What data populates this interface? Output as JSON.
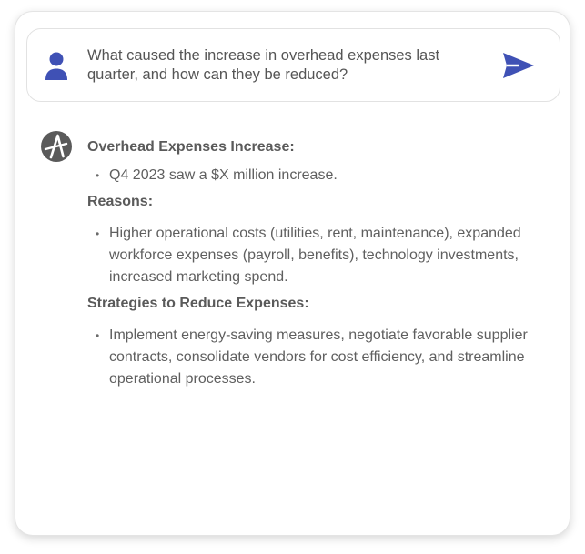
{
  "query": {
    "text": "What caused the increase in overhead expenses last quarter, and how can they be reduced?",
    "user_icon": "user-icon",
    "send_icon": "send-icon"
  },
  "response": {
    "assistant_icon": "assistant-logo-icon",
    "sections": [
      {
        "heading": "Overhead Expenses Increase:",
        "bullets": [
          "Q4 2023 saw a $X million increase."
        ]
      },
      {
        "heading": "Reasons:",
        "bullets": [
          "Higher operational costs (utilities, rent, maintenance), expanded workforce expenses (payroll, benefits), technology investments, increased marketing spend."
        ]
      },
      {
        "heading": "Strategies to Reduce Expenses:",
        "bullets": [
          "Implement energy-saving measures, negotiate favorable supplier contracts, consolidate vendors for cost efficiency, and streamline operational processes."
        ]
      }
    ]
  },
  "colors": {
    "accent": "#3f51b5",
    "text": "#5f5f5f",
    "logo": "#5a5a5a",
    "border": "#e2e2e2"
  }
}
